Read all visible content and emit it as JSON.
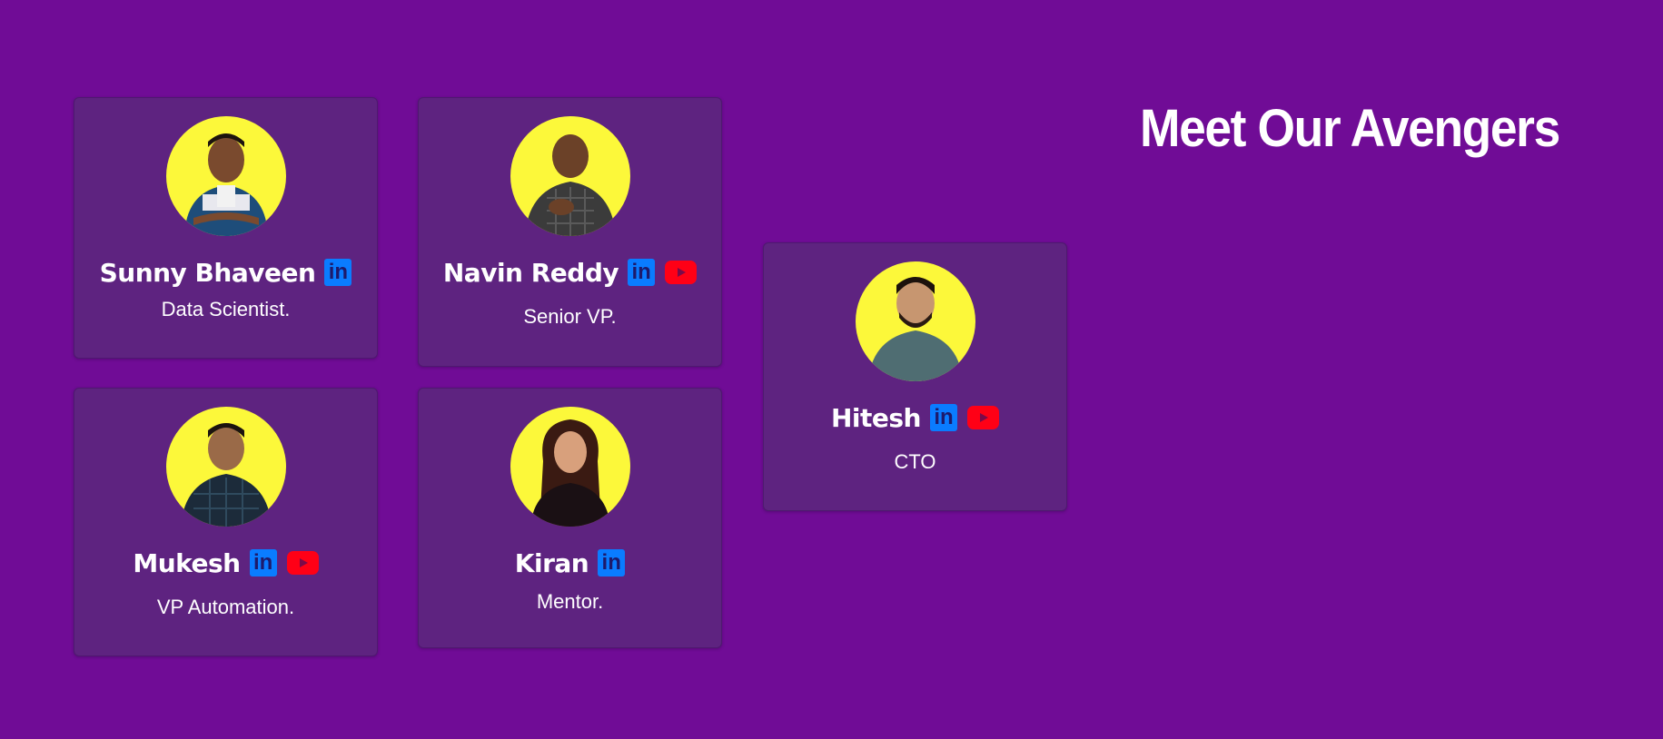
{
  "page": {
    "title": "Meet Our Avengers"
  },
  "colors": {
    "background": "#700c96",
    "card": "#5e2380",
    "avatar_bg": "#fcf83a",
    "linkedin": "#0a7cff",
    "youtube": "#ff0016"
  },
  "team": [
    {
      "name": "Sunny Bhaveen",
      "role": "Data Scientist.",
      "links": [
        "linkedin-icon"
      ]
    },
    {
      "name": "Navin Reddy",
      "role": "Senior VP.",
      "links": [
        "linkedin-icon",
        "youtube-icon"
      ]
    },
    {
      "name": "Hitesh",
      "role": "CTO",
      "links": [
        "linkedin-icon",
        "youtube-icon"
      ]
    },
    {
      "name": "Mukesh",
      "role": "VP Automation.",
      "links": [
        "linkedin-icon",
        "youtube-icon"
      ]
    },
    {
      "name": "Kiran",
      "role": "Mentor.",
      "links": [
        "linkedin-icon"
      ]
    }
  ],
  "icons": {
    "linkedin_text": "in"
  }
}
